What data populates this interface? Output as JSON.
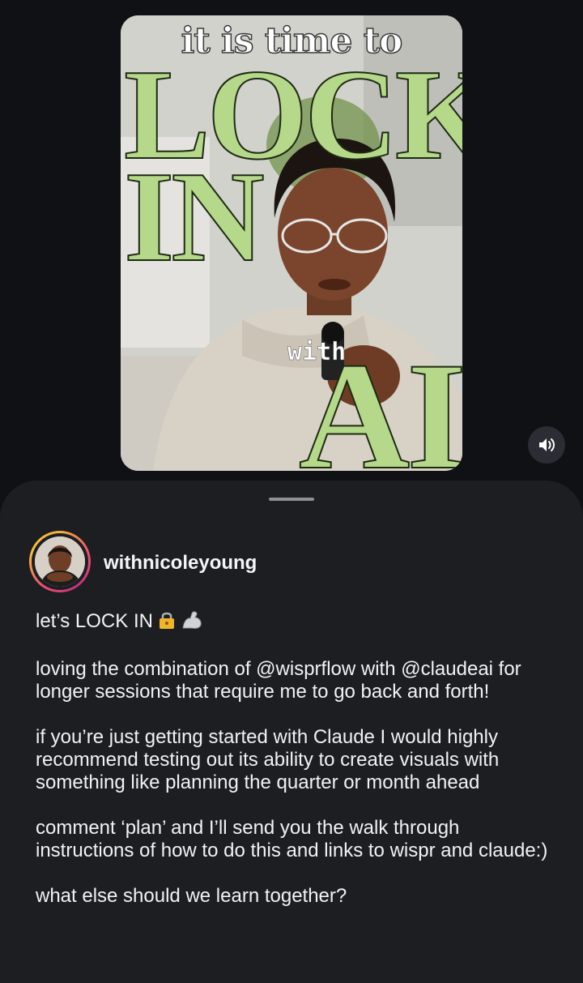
{
  "video": {
    "title_small": "it is time to",
    "title_lock": "LOCK",
    "title_in": "IN",
    "title_with": "with",
    "title_ai": "AI"
  },
  "controls": {
    "sound_icon": "speaker-volume-icon"
  },
  "post": {
    "username": "withnicoleyoung",
    "avatar_icon": "profile-avatar",
    "caption": {
      "line1": "let’s LOCK IN",
      "line1_emojis": [
        "lock-icon",
        "flexed-biceps-icon"
      ],
      "para2": "loving the combination of @wisprflow with @claudeai for longer sessions that require me to go back and forth!",
      "para3": "if you’re just getting started with Claude I would highly recommend testing out its ability to create visuals with something like planning the quarter or month ahead",
      "para4": "comment ‘plan’ and I’ll send you the walk through instructions of how to do this and links to wispr and claude:)",
      "para5": "what else should we learn together?"
    }
  },
  "colors": {
    "background": "#0f1115",
    "sheet": "#1c1e22",
    "title_green": "#b5d88a"
  }
}
